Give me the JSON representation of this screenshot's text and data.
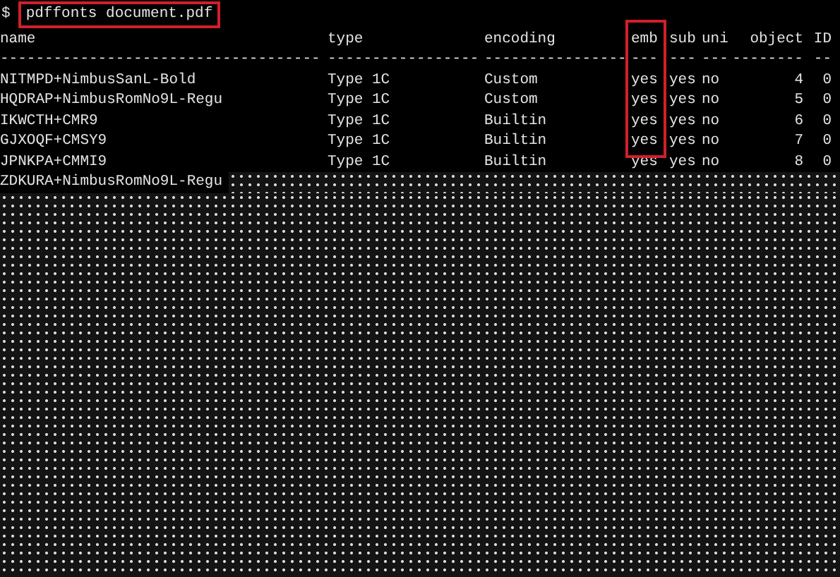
{
  "prompt": "$",
  "command": "pdffonts document.pdf",
  "columns": [
    {
      "label": "name",
      "rule": "------------------------------------"
    },
    {
      "label": "type",
      "rule": "-----------------"
    },
    {
      "label": "encoding",
      "rule": "----------------"
    },
    {
      "label": "emb",
      "rule": "---",
      "highlighted": true
    },
    {
      "label": "sub",
      "rule": "---"
    },
    {
      "label": "uni",
      "rule": "---"
    },
    {
      "label": "object",
      "rule": "--------"
    },
    {
      "label": "ID",
      "rule": "--"
    }
  ],
  "rows": [
    [
      "NITMPD+NimbusSanL-Bold",
      "Type 1C",
      "Custom",
      "yes",
      "yes",
      "no",
      "4",
      "0"
    ],
    [
      "HQDRAP+NimbusRomNo9L-Regu",
      "Type 1C",
      "Custom",
      "yes",
      "yes",
      "no",
      "5",
      "0"
    ],
    [
      "IKWCTH+CMR9",
      "Type 1C",
      "Builtin",
      "yes",
      "yes",
      "no",
      "6",
      "0"
    ],
    [
      "GJXOQF+CMSY9",
      "Type 1C",
      "Builtin",
      "yes",
      "yes",
      "no",
      "7",
      "0"
    ],
    [
      "JPNKPA+CMMI9",
      "Type 1C",
      "Builtin",
      "yes",
      "yes",
      "no",
      "8",
      "0"
    ]
  ],
  "partial_row": {
    "name": "ZDKURA+NimbusRomNo9L-Regu"
  }
}
